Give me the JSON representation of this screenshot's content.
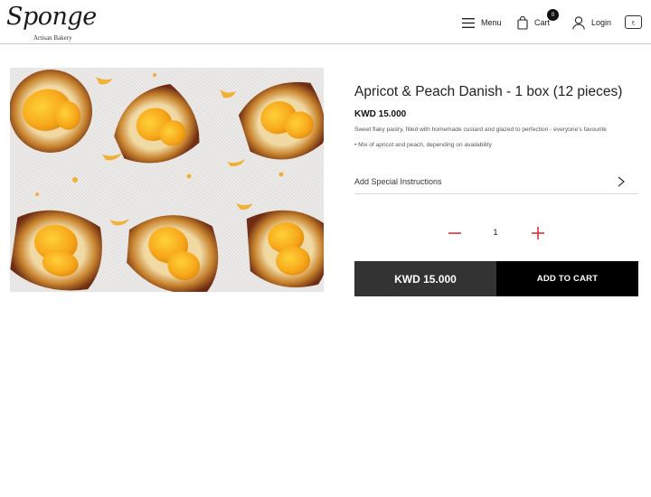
{
  "brand": {
    "name": "Sponge",
    "tagline": "Artisan Bakery"
  },
  "header": {
    "menu_label": "Menu",
    "cart_label": "Cart",
    "cart_count": "0",
    "login_label": "Login",
    "language_label": "ع"
  },
  "product": {
    "title": "Apricot & Peach Danish - 1 box (12 pieces)",
    "price": "KWD 15.000",
    "description": "Sweet flaky pastry, filled with homemade custard and glazed to perfection - everyone's favourite",
    "note": "• Mix of apricot and peach, depending on availability",
    "image_icon": "apricot-danish-photo"
  },
  "instructions": {
    "label": "Add Special Instructions"
  },
  "quantity": {
    "value": "1"
  },
  "purchase": {
    "total": "KWD 15.000",
    "add_label": "ADD TO CART"
  },
  "colors": {
    "price_box": "#333333",
    "add_button": "#000000",
    "qty_controls": "#d9262a",
    "accent_glaze": "#f2a81a"
  }
}
